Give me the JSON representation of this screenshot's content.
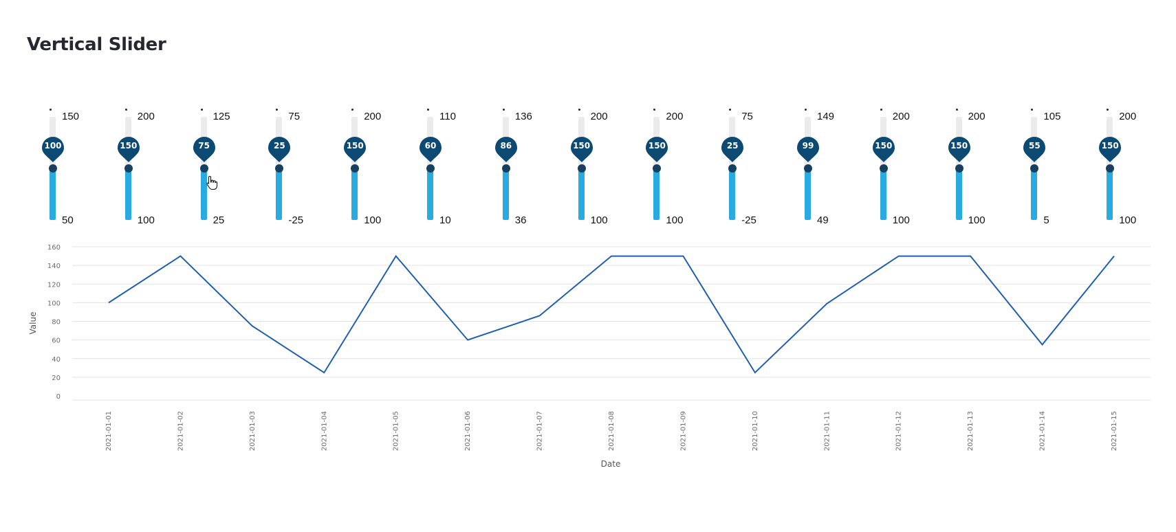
{
  "page": {
    "title": "Vertical Slider"
  },
  "sliders": [
    {
      "value": 100,
      "min": 50,
      "max": 150
    },
    {
      "value": 150,
      "min": 100,
      "max": 200
    },
    {
      "value": 75,
      "min": 25,
      "max": 125
    },
    {
      "value": 25,
      "min": -25,
      "max": 75
    },
    {
      "value": 150,
      "min": 100,
      "max": 200
    },
    {
      "value": 60,
      "min": 10,
      "max": 110
    },
    {
      "value": 86,
      "min": 36,
      "max": 136
    },
    {
      "value": 150,
      "min": 100,
      "max": 200
    },
    {
      "value": 150,
      "min": 100,
      "max": 200
    },
    {
      "value": 25,
      "min": -25,
      "max": 75
    },
    {
      "value": 99,
      "min": 49,
      "max": 149
    },
    {
      "value": 150,
      "min": 100,
      "max": 200
    },
    {
      "value": 150,
      "min": 100,
      "max": 200
    },
    {
      "value": 55,
      "min": 5,
      "max": 105
    },
    {
      "value": 150,
      "min": 100,
      "max": 200
    }
  ],
  "colors": {
    "track": "#ebebeb",
    "fill": "#29abe2",
    "handle": "#173f5f",
    "pin": "#0d4a73",
    "line": "#1f5fb0",
    "grid": "#e3e3e3"
  },
  "chart_data": {
    "type": "line",
    "x": [
      "2021-01-01",
      "2021-01-02",
      "2021-01-03",
      "2021-01-04",
      "2021-01-05",
      "2021-01-06",
      "2021-01-07",
      "2021-01-08",
      "2021-01-09",
      "2021-01-10",
      "2021-01-11",
      "2021-01-12",
      "2021-01-13",
      "2021-01-14",
      "2021-01-15"
    ],
    "values": [
      100,
      150,
      75,
      25,
      150,
      60,
      86,
      150,
      150,
      25,
      99,
      150,
      150,
      55,
      150
    ],
    "xlabel": "Date",
    "ylabel": "Value",
    "yticks": [
      0,
      20,
      40,
      60,
      80,
      100,
      120,
      140,
      160
    ],
    "ylim": [
      0,
      160
    ],
    "grid": true
  }
}
